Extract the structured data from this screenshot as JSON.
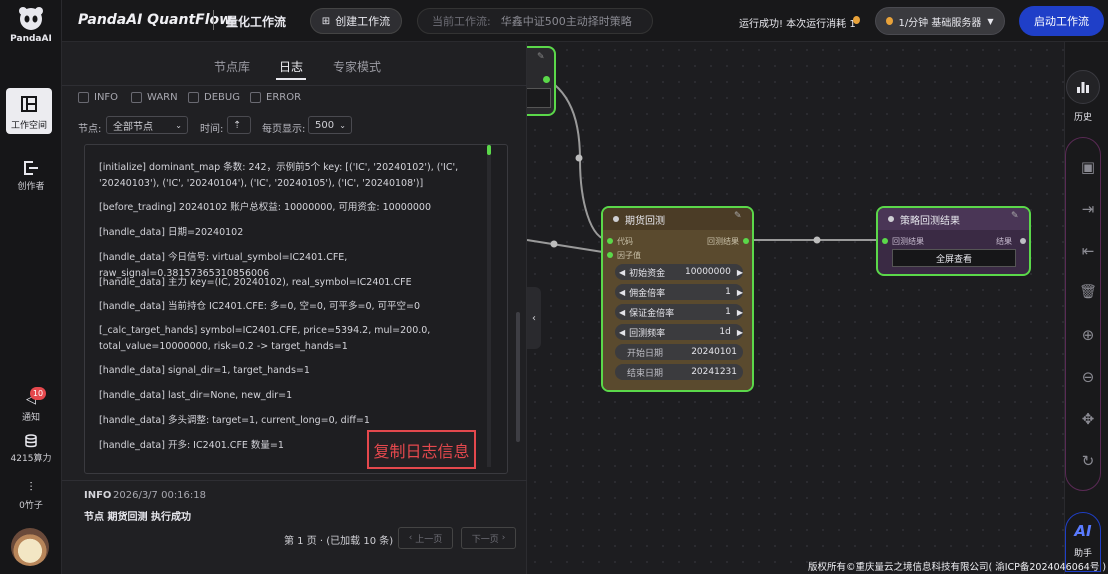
{
  "brand": {
    "logo_text": "PandaAI",
    "app_title": "PandaAI QuantFlow",
    "subtitle": "量化工作流"
  },
  "topbar": {
    "create_label": "创建工作流",
    "current_label": "当前工作流:",
    "current_value": "华鑫中证500主动择时策略",
    "status_text": "运行成功! 本次运行消耗 1",
    "server_label": "1/分钟  基础服务器",
    "start_label": "启动工作流"
  },
  "rail": {
    "workspace": "工作空间",
    "creator": "创作者",
    "notify": "通知",
    "notify_badge": "10",
    "compute": "4215算力",
    "bamboo": "0竹子"
  },
  "panel": {
    "tabs": [
      "节点库",
      "日志",
      "专家模式"
    ],
    "active_tab": "日志",
    "levels": [
      "INFO",
      "WARN",
      "DEBUG",
      "ERROR"
    ],
    "node_label": "节点:",
    "node_value": "全部节点",
    "time_label": "时间:",
    "page_size_label": "每页显示:",
    "page_size_value": "500",
    "log_lines": [
      "[initialize] dominant_map 条数: 242，示例前5个 key: [('IC', '20240102'), ('IC', '20240103'), ('IC', '20240104'), ('IC', '20240105'), ('IC', '20240108')]",
      "[before_trading] 20240102 账户总权益: 10000000, 可用资金: 10000000",
      "[handle_data] 日期=20240102",
      "[handle_data] 今日信号: virtual_symbol=IC2401.CFE, raw_signal=0.38157365310856006",
      "[handle_data] 主力 key=(IC, 20240102), real_symbol=IC2401.CFE",
      "[handle_data] 当前持仓 IC2401.CFE: 多=0, 空=0, 可平多=0, 可平空=0",
      "[_calc_target_hands] symbol=IC2401.CFE, price=5394.2, mul=200.0, total_value=10000000, risk=0.2 -> target_hands=1",
      "[handle_data] signal_dir=1, target_hands=1",
      "[handle_data] last_dir=None, new_dir=1",
      "[handle_data] 多头调整: target=1, current_long=0, diff=1",
      "[handle_data] 开多: IC2401.CFE 数量=1"
    ],
    "copy_annotation": "复制日志信息",
    "entry_level": "INFO",
    "entry_time": "2026/3/7 00:16:18",
    "entry_message": "节点 期货回测 执行成功",
    "pager_text": "第 1 页 · (已加载 10 条)",
    "prev_label": "上一页",
    "next_label": "下一页"
  },
  "nodes": {
    "backtest": {
      "title": "期货回测",
      "in_ports": [
        "代码",
        "因子值"
      ],
      "out_port": "回测结果",
      "params": [
        {
          "label": "初始资金",
          "value": "10000000"
        },
        {
          "label": "佣金倍率",
          "value": "1"
        },
        {
          "label": "保证金倍率",
          "value": "1"
        },
        {
          "label": "回测频率",
          "value": "1d"
        }
      ],
      "dates": [
        {
          "label": "开始日期",
          "value": "20240101"
        },
        {
          "label": "结束日期",
          "value": "20241231"
        }
      ]
    },
    "result": {
      "title": "策略回测结果",
      "in_port": "回测结果",
      "out_port": "结果",
      "button": "全屏查看"
    }
  },
  "right": {
    "history": "历史",
    "assistant": "助手",
    "assistant_logo": "AI"
  },
  "footer": {
    "copyright": "版权所有©重庆量云之境信息科技有限公司( 渝ICP备2024046064号 )"
  },
  "colors": {
    "accent_green": "#5bd84a",
    "primary_blue": "#1f3fc8",
    "copy_red": "#e5484d"
  }
}
